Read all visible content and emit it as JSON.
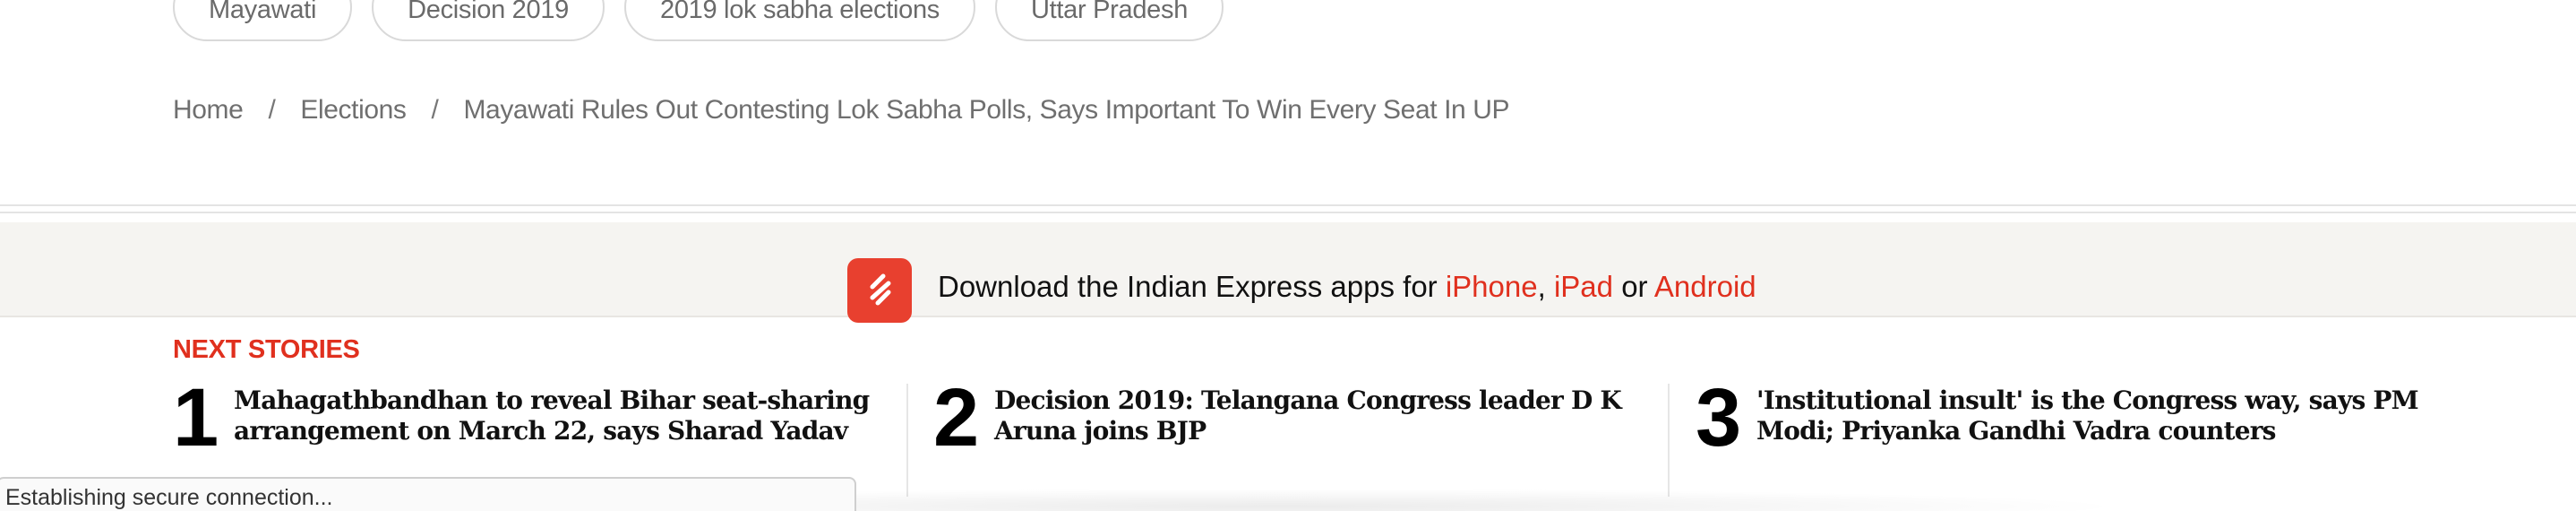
{
  "tags": [
    "Mayawati",
    "Decision 2019",
    "2019 lok sabha elections",
    "Uttar Pradesh"
  ],
  "breadcrumb": {
    "home": "Home",
    "section": "Elections",
    "current": "Mayawati Rules Out Contesting Lok Sabha Polls, Says Important To Win Every Seat In UP",
    "separator": "/"
  },
  "app_promo": {
    "text": "Download the Indian Express apps for",
    "iphone": "iPhone",
    "comma": ",",
    "ipad": "iPad",
    "or": "or",
    "android": "Android",
    "logo_icon": "indian-express-logo-icon",
    "brand_color": "#e8402f"
  },
  "next_stories": {
    "label": "NEXT STORIES",
    "items": [
      {
        "number": "1",
        "title": "Mahagathbandhan to reveal Bihar seat-sharing arrangement on March 22, says Sharad Yadav"
      },
      {
        "number": "2",
        "title": "Decision 2019: Telangana Congress leader D K Aruna joins BJP"
      },
      {
        "number": "3",
        "title": "'Institutional insult' is the Congress way, says PM Modi; Priyanka Gandhi Vadra counters"
      }
    ]
  },
  "status_bar": {
    "text": "Establishing secure connection..."
  },
  "colors": {
    "accent": "#e0301e",
    "band_bg": "#f5f4f1"
  }
}
